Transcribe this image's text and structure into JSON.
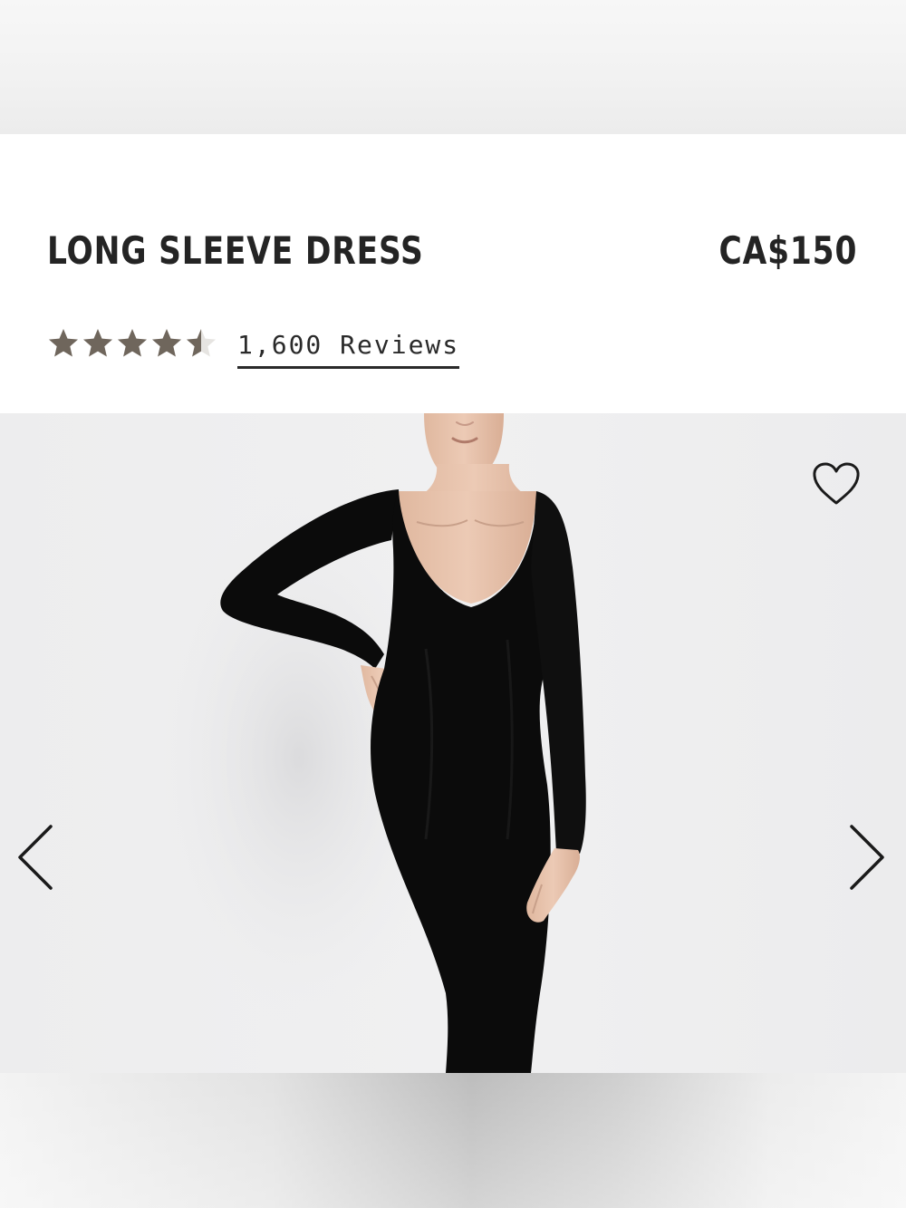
{
  "product": {
    "title": "LONG SLEEVE DRESS",
    "price": "CA$150",
    "rating": 4.5,
    "reviews_label": "1,600 Reviews"
  },
  "gallery": {
    "image_alt": "Model wearing a black long sleeve scoop neck maxi dress",
    "favorite_icon": "heart-outline-icon",
    "prev_icon": "chevron-left-icon",
    "next_icon": "chevron-right-icon"
  },
  "colors": {
    "star": "#6f665c",
    "text": "#242424",
    "dress": "#0b0b0b",
    "skin": "#e6c3ac",
    "background": "#eeeeef"
  }
}
